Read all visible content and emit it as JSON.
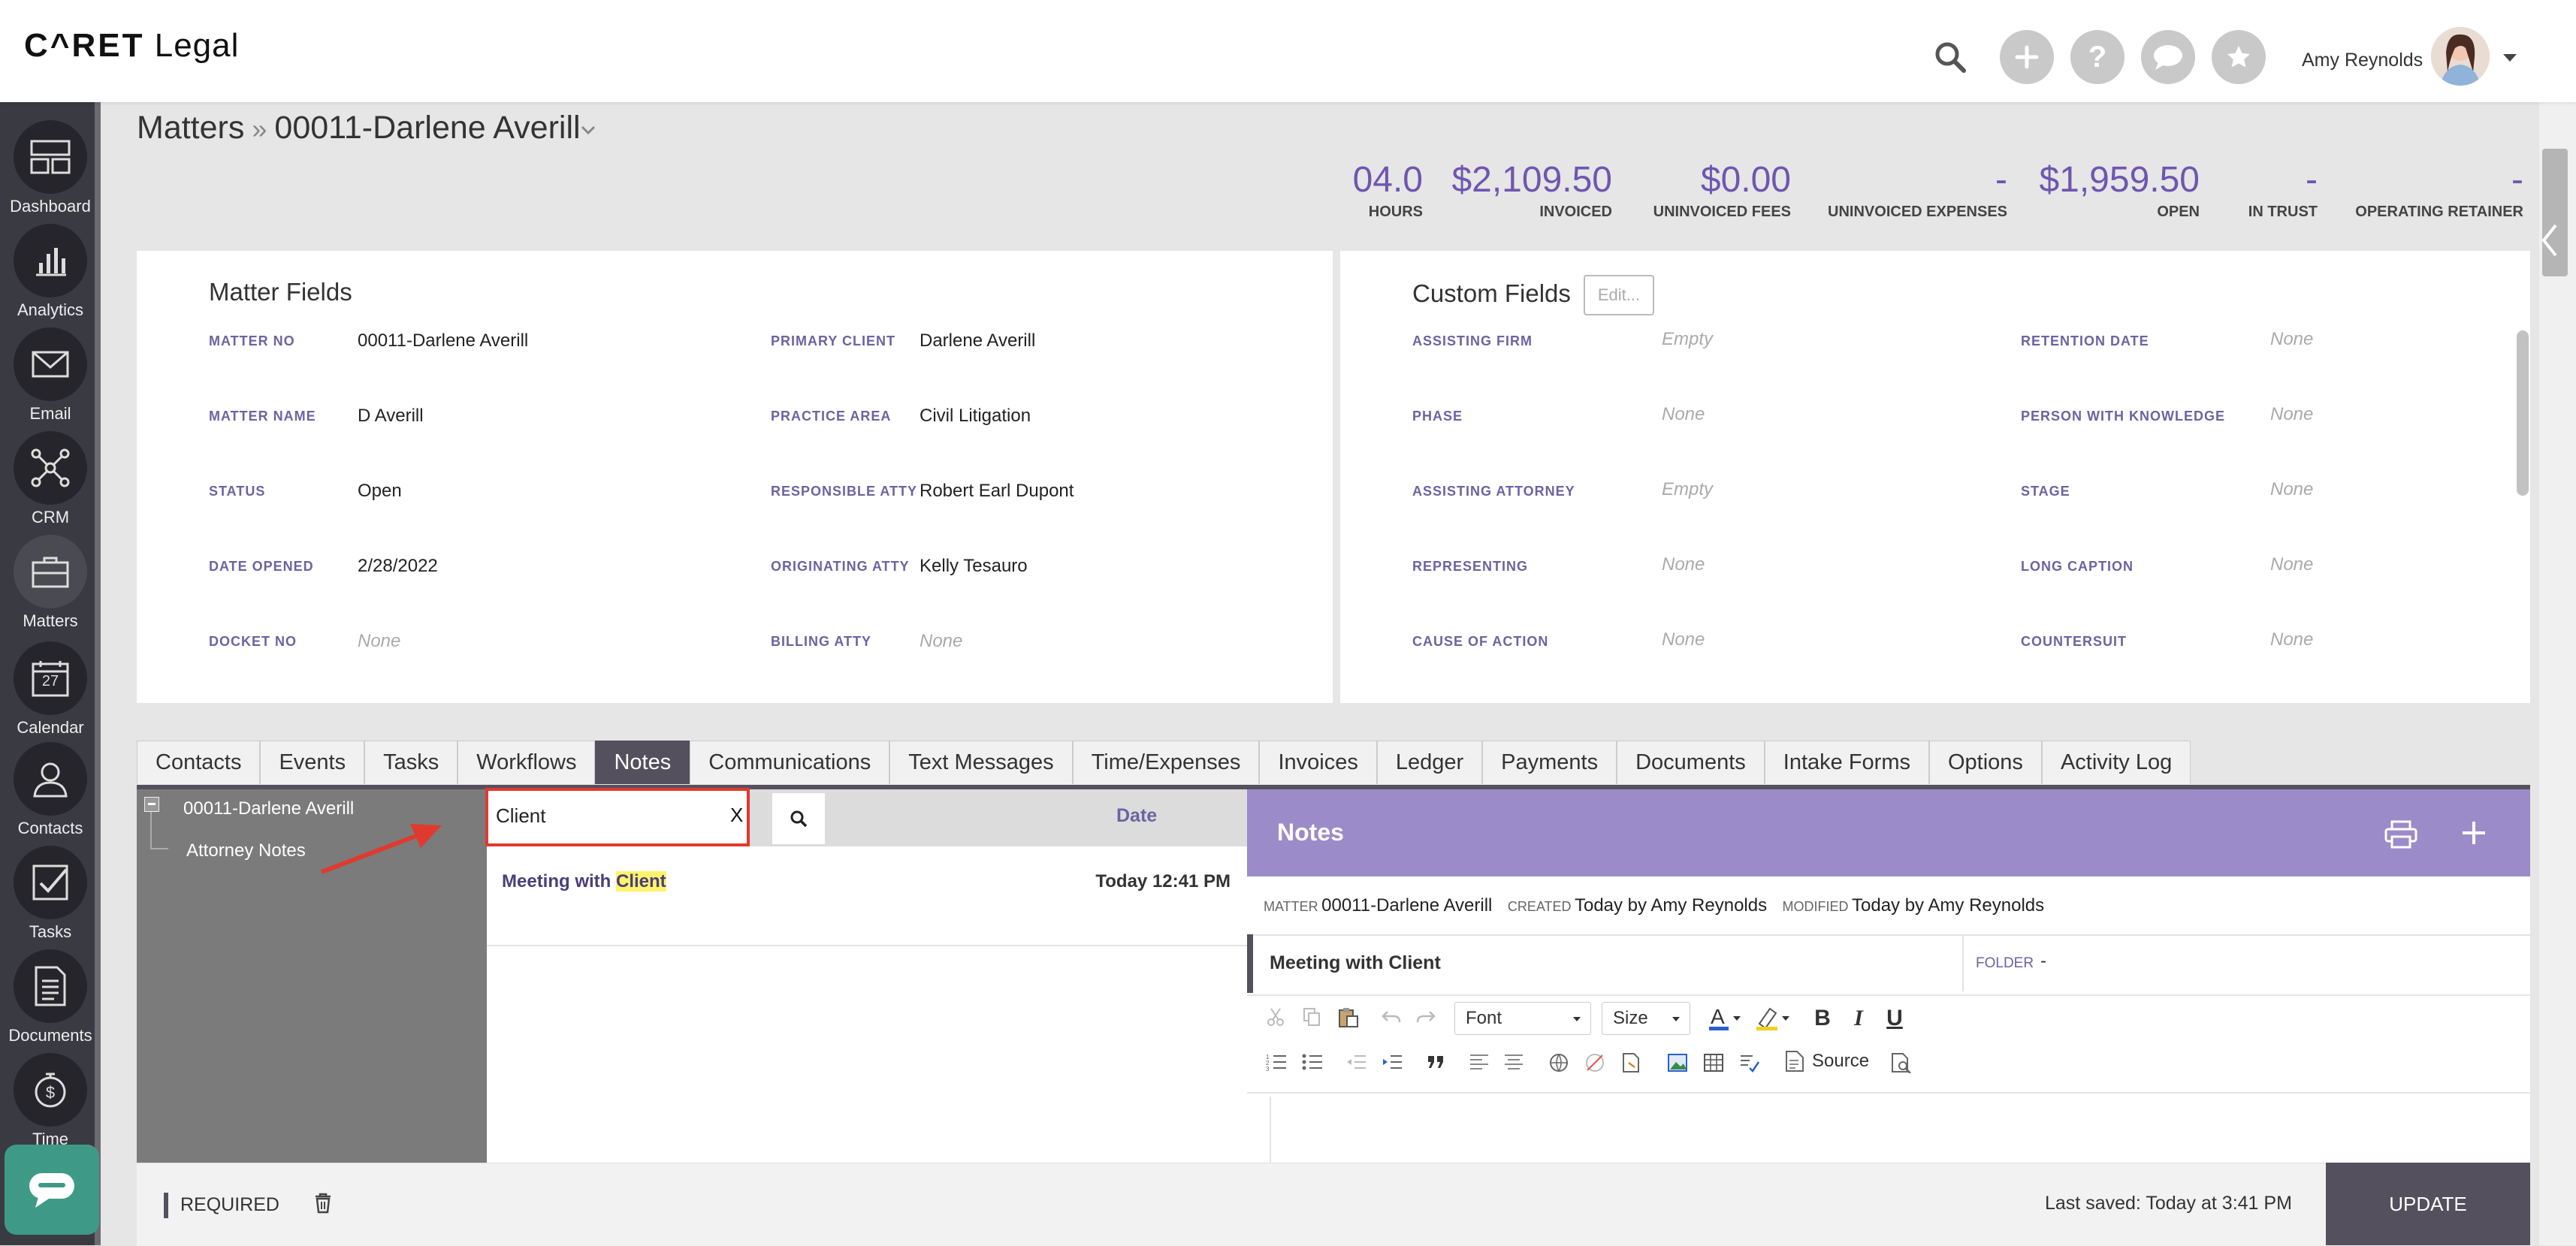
{
  "app": {
    "logo_left": "C^RET",
    "logo_right": "Legal"
  },
  "header": {
    "user_name": "Amy Reynolds"
  },
  "sidebar": {
    "items": [
      {
        "label": "Dashboard",
        "icon": "dashboard-icon"
      },
      {
        "label": "Analytics",
        "icon": "analytics-icon"
      },
      {
        "label": "Email",
        "icon": "email-icon"
      },
      {
        "label": "CRM",
        "icon": "crm-icon"
      },
      {
        "label": "Matters",
        "icon": "briefcase-icon"
      },
      {
        "label": "Calendar",
        "icon": "calendar-icon"
      },
      {
        "label": "Contacts",
        "icon": "contacts-icon"
      },
      {
        "label": "Tasks",
        "icon": "tasks-icon"
      },
      {
        "label": "Documents",
        "icon": "documents-icon"
      },
      {
        "label": "Time",
        "icon": "time-icon"
      }
    ],
    "calendar_day": "27"
  },
  "breadcrumb": {
    "root": "Matters",
    "separator": "»",
    "current": "00011-Darlene Averill"
  },
  "stats": [
    {
      "value": "04.0",
      "label": "HOURS"
    },
    {
      "value": "$2,109.50",
      "label": "INVOICED"
    },
    {
      "value": "$0.00",
      "label": "UNINVOICED FEES"
    },
    {
      "value": "-",
      "label": "UNINVOICED EXPENSES"
    },
    {
      "value": "$1,959.50",
      "label": "OPEN"
    },
    {
      "value": "-",
      "label": "IN TRUST"
    },
    {
      "value": "-",
      "label": "OPERATING RETAINER"
    }
  ],
  "matter_fields": {
    "title": "Matter Fields",
    "left": [
      {
        "label": "MATTER NO",
        "value": "00011-Darlene Averill"
      },
      {
        "label": "MATTER NAME",
        "value": "D Averill"
      },
      {
        "label": "STATUS",
        "value": "Open"
      },
      {
        "label": "DATE OPENED",
        "value": "2/28/2022"
      },
      {
        "label": "DOCKET NO",
        "value": "None"
      }
    ],
    "right": [
      {
        "label": "PRIMARY CLIENT",
        "value": "Darlene Averill"
      },
      {
        "label": "PRACTICE AREA",
        "value": "Civil Litigation"
      },
      {
        "label": "RESPONSIBLE ATTY",
        "value": "Robert Earl Dupont"
      },
      {
        "label": "ORIGINATING ATTY",
        "value": "Kelly Tesauro"
      },
      {
        "label": "BILLING ATTY",
        "value": "None"
      }
    ]
  },
  "custom_fields": {
    "title": "Custom Fields",
    "edit_label": "Edit...",
    "left": [
      {
        "label": "ASSISTING FIRM",
        "value": "Empty"
      },
      {
        "label": "PHASE",
        "value": "None"
      },
      {
        "label": "ASSISTING ATTORNEY",
        "value": "Empty"
      },
      {
        "label": "REPRESENTING",
        "value": "None"
      },
      {
        "label": "CAUSE OF ACTION",
        "value": "None"
      }
    ],
    "right": [
      {
        "label": "RETENTION DATE",
        "value": "None"
      },
      {
        "label": "PERSON WITH KNOWLEDGE",
        "value": "None"
      },
      {
        "label": "STAGE",
        "value": "None"
      },
      {
        "label": "LONG CAPTION",
        "value": "None"
      },
      {
        "label": "COUNTERSUIT",
        "value": "None"
      }
    ]
  },
  "tabs": [
    "Contacts",
    "Events",
    "Tasks",
    "Workflows",
    "Notes",
    "Communications",
    "Text Messages",
    "Time/Expenses",
    "Invoices",
    "Ledger",
    "Payments",
    "Documents",
    "Intake Forms",
    "Options",
    "Activity Log"
  ],
  "active_tab": "Notes",
  "tree": {
    "root": "00011-Darlene Averill",
    "child": "Attorney Notes"
  },
  "notes_list": {
    "search_value": "Client",
    "clear_label": "X",
    "date_header": "Date",
    "rows": [
      {
        "title_pre": "Meeting with ",
        "title_highlight": "Client",
        "date": "Today 12:41 PM"
      }
    ]
  },
  "editor": {
    "header_title": "Notes",
    "matter_label": "MATTER",
    "matter_value": "00011-Darlene Averill",
    "created_label": "CREATED",
    "created_value": "Today by Amy Reynolds",
    "modified_label": "MODIFIED",
    "modified_value": "Today by Amy Reynolds",
    "note_title": "Meeting with Client",
    "folder_label": "FOLDER",
    "folder_value": "-",
    "font_select": "Font",
    "size_select": "Size",
    "bold": "B",
    "italic": "I",
    "underline": "U",
    "source_label": "Source"
  },
  "footer": {
    "required_label": "REQUIRED",
    "last_saved": "Last saved: Today at 3:41 PM",
    "update_label": "UPDATE"
  },
  "colors": {
    "accent": "#6e56b0",
    "notes_header": "#9c8bc9",
    "sidebar": "#3a3a42",
    "annotation": "#e03a2e"
  }
}
